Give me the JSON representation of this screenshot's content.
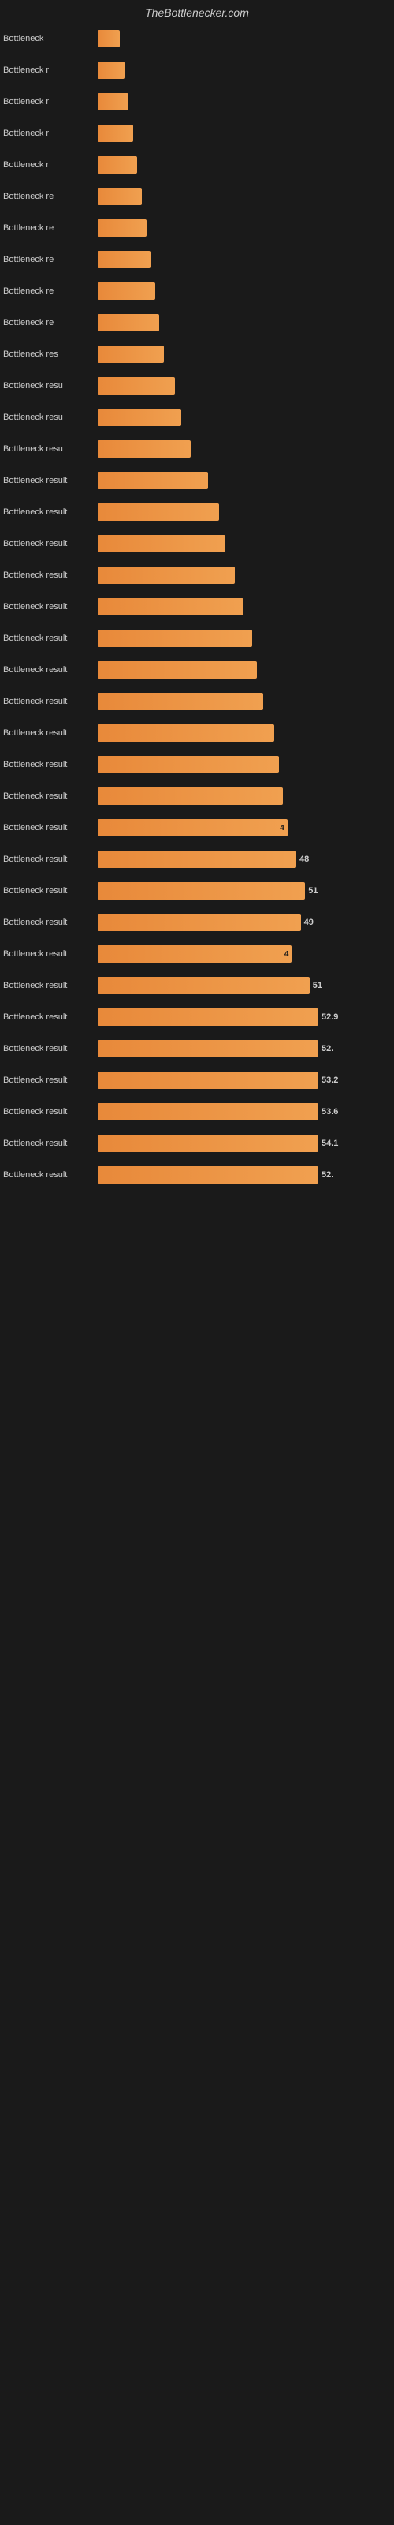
{
  "site": {
    "title": "TheBottlenecker.com"
  },
  "chart": {
    "rows": [
      {
        "label": "Bottleneck",
        "width": 10,
        "value": ""
      },
      {
        "label": "Bottleneck r",
        "width": 12,
        "value": ""
      },
      {
        "label": "Bottleneck r",
        "width": 14,
        "value": ""
      },
      {
        "label": "Bottleneck r",
        "width": 16,
        "value": ""
      },
      {
        "label": "Bottleneck r",
        "width": 18,
        "value": ""
      },
      {
        "label": "Bottleneck re",
        "width": 20,
        "value": ""
      },
      {
        "label": "Bottleneck re",
        "width": 22,
        "value": ""
      },
      {
        "label": "Bottleneck re",
        "width": 24,
        "value": ""
      },
      {
        "label": "Bottleneck re",
        "width": 26,
        "value": ""
      },
      {
        "label": "Bottleneck re",
        "width": 28,
        "value": ""
      },
      {
        "label": "Bottleneck res",
        "width": 30,
        "value": ""
      },
      {
        "label": "Bottleneck resu",
        "width": 35,
        "value": ""
      },
      {
        "label": "Bottleneck resu",
        "width": 38,
        "value": ""
      },
      {
        "label": "Bottleneck resu",
        "width": 42,
        "value": ""
      },
      {
        "label": "Bottleneck result",
        "width": 50,
        "value": ""
      },
      {
        "label": "Bottleneck result",
        "width": 55,
        "value": ""
      },
      {
        "label": "Bottleneck result",
        "width": 58,
        "value": ""
      },
      {
        "label": "Bottleneck result",
        "width": 62,
        "value": ""
      },
      {
        "label": "Bottleneck result",
        "width": 66,
        "value": ""
      },
      {
        "label": "Bottleneck result",
        "width": 70,
        "value": ""
      },
      {
        "label": "Bottleneck result",
        "width": 72,
        "value": ""
      },
      {
        "label": "Bottleneck result",
        "width": 75,
        "value": ""
      },
      {
        "label": "Bottleneck result",
        "width": 80,
        "value": ""
      },
      {
        "label": "Bottleneck result",
        "width": 82,
        "value": ""
      },
      {
        "label": "Bottleneck result",
        "width": 84,
        "value": ""
      },
      {
        "label": "Bottleneck result",
        "width": 86,
        "value": "4"
      },
      {
        "label": "Bottleneck result",
        "width": 90,
        "value": "48"
      },
      {
        "label": "Bottleneck result",
        "width": 94,
        "value": "51"
      },
      {
        "label": "Bottleneck result",
        "width": 92,
        "value": "49"
      },
      {
        "label": "Bottleneck result",
        "width": 88,
        "value": "4"
      },
      {
        "label": "Bottleneck result",
        "width": 96,
        "value": "51"
      },
      {
        "label": "Bottleneck result",
        "width": 100,
        "value": "52.9"
      },
      {
        "label": "Bottleneck result",
        "width": 100,
        "value": "52."
      },
      {
        "label": "Bottleneck result",
        "width": 100,
        "value": "53.2"
      },
      {
        "label": "Bottleneck result",
        "width": 100,
        "value": "53.6"
      },
      {
        "label": "Bottleneck result",
        "width": 100,
        "value": "54.1"
      },
      {
        "label": "Bottleneck result",
        "width": 100,
        "value": "52."
      }
    ]
  }
}
